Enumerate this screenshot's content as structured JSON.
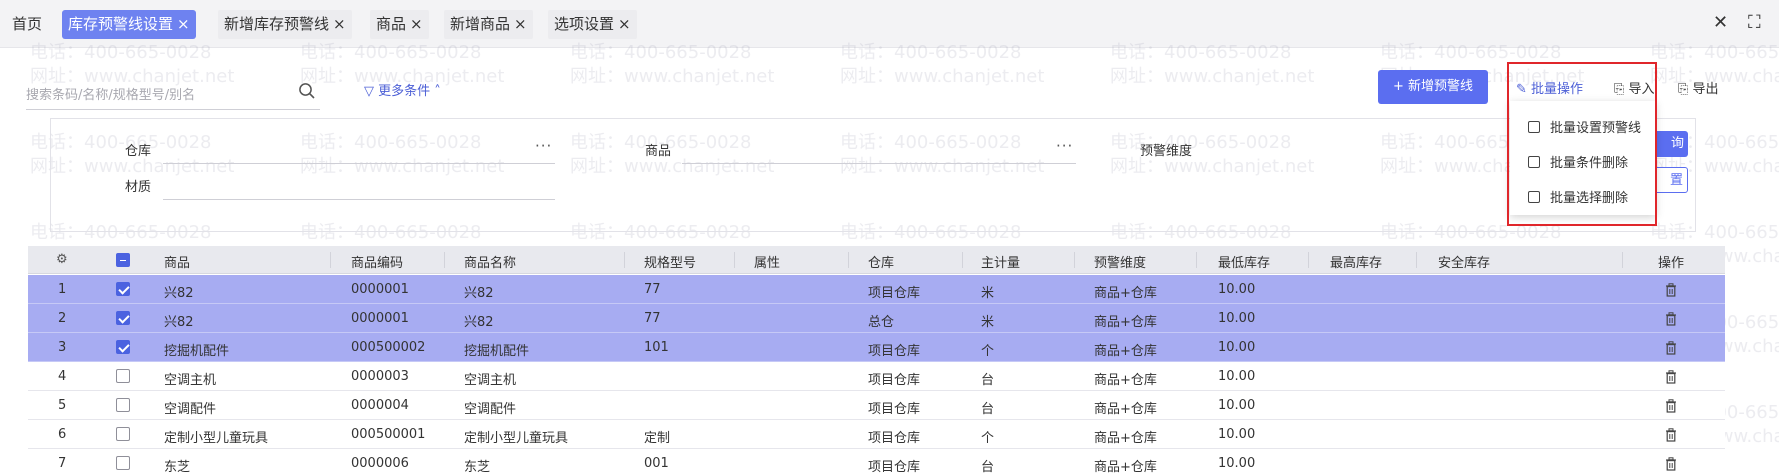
{
  "tabs": [
    {
      "label": "首页",
      "closable": false,
      "active": false
    },
    {
      "label": "库存预警线设置",
      "closable": true,
      "active": true
    },
    {
      "label": "新增库存预警线",
      "closable": true,
      "active": false
    },
    {
      "label": "商品",
      "closable": true,
      "active": false
    },
    {
      "label": "新增商品",
      "closable": true,
      "active": false
    },
    {
      "label": "选项设置",
      "closable": true,
      "active": false
    }
  ],
  "close_glyph": "×",
  "window": {
    "close": "✕",
    "fullscreen": "⛶"
  },
  "watermark": {
    "phone": "电话：400-665-0028",
    "site": "网址：www.chanjet.net"
  },
  "search": {
    "placeholder": "搜索条码/名称/规格型号/别名"
  },
  "more_conditions": "更多条件",
  "toolbar": {
    "new_button": "+ 新增预警线",
    "batch": "批量操作",
    "import": "导入",
    "export": "导出"
  },
  "filters": {
    "warehouse": "仓库",
    "product": "商品",
    "dimension": "预警维度",
    "material": "材质",
    "ellipsis": "···"
  },
  "panel_buttons": {
    "query": "询",
    "reset": "置"
  },
  "batch_menu": [
    "批量设置预警线",
    "批量条件删除",
    "批量选择删除"
  ],
  "table": {
    "columns": [
      "商品",
      "商品编码",
      "商品名称",
      "规格型号",
      "属性",
      "仓库",
      "主计量",
      "预警维度",
      "最低库存",
      "最高库存",
      "安全库存",
      "操作"
    ],
    "rows": [
      {
        "no": "1",
        "checked": true,
        "product": "兴82",
        "code": "0000001",
        "name": "兴82",
        "spec": "77",
        "attr": "",
        "warehouse": "项目仓库",
        "unit": "米",
        "dimension": "商品+仓库",
        "min": "10.00",
        "max": "",
        "safe": ""
      },
      {
        "no": "2",
        "checked": true,
        "product": "兴82",
        "code": "0000001",
        "name": "兴82",
        "spec": "77",
        "attr": "",
        "warehouse": "总仓",
        "unit": "米",
        "dimension": "商品+仓库",
        "min": "10.00",
        "max": "",
        "safe": ""
      },
      {
        "no": "3",
        "checked": true,
        "product": "挖掘机配件",
        "code": "000500002",
        "name": "挖掘机配件",
        "spec": "101",
        "attr": "",
        "warehouse": "项目仓库",
        "unit": "个",
        "dimension": "商品+仓库",
        "min": "10.00",
        "max": "",
        "safe": ""
      },
      {
        "no": "4",
        "checked": false,
        "product": "空调主机",
        "code": "0000003",
        "name": "空调主机",
        "spec": "",
        "attr": "",
        "warehouse": "项目仓库",
        "unit": "台",
        "dimension": "商品+仓库",
        "min": "10.00",
        "max": "",
        "safe": ""
      },
      {
        "no": "5",
        "checked": false,
        "product": "空调配件",
        "code": "0000004",
        "name": "空调配件",
        "spec": "",
        "attr": "",
        "warehouse": "项目仓库",
        "unit": "台",
        "dimension": "商品+仓库",
        "min": "10.00",
        "max": "",
        "safe": ""
      },
      {
        "no": "6",
        "checked": false,
        "product": "定制小型儿童玩具",
        "code": "000500001",
        "name": "定制小型儿童玩具",
        "spec": "定制",
        "attr": "",
        "warehouse": "项目仓库",
        "unit": "个",
        "dimension": "商品+仓库",
        "min": "10.00",
        "max": "",
        "safe": ""
      },
      {
        "no": "7",
        "checked": false,
        "product": "东芝",
        "code": "0000006",
        "name": "东芝",
        "spec": "001",
        "attr": "",
        "warehouse": "项目仓库",
        "unit": "台",
        "dimension": "商品+仓库",
        "min": "10.00",
        "max": "",
        "safe": ""
      }
    ]
  },
  "colors": {
    "accent": "#5b6ef0",
    "selected_row": "#a7acf2",
    "highlight_box": "#e0262b"
  }
}
